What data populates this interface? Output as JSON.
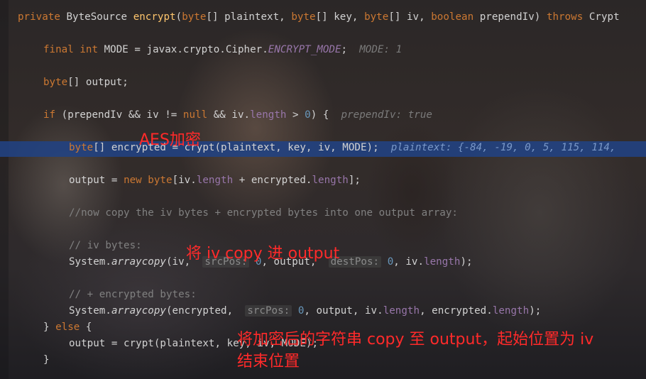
{
  "code_lines": [
    "private ByteSource encrypt(byte[] plaintext, byte[] key, byte[] iv, boolean prependIv) throws Crypt",
    "final int MODE = javax.crypto.Cipher.ENCRYPT_MODE;",
    "byte[] output;",
    "if (prependIv && iv != null && iv.length > 0) {",
    "byte[] encrypted = crypt(plaintext, key, iv, MODE);",
    "output = new byte[iv.length + encrypted.length];",
    "//now copy the iv bytes + encrypted bytes into one output array:",
    "// iv bytes:",
    "System.arraycopy(iv, srcPos: 0, output, destPos: 0, iv.length);",
    "// + encrypted bytes:",
    "System.arraycopy(encrypted, srcPos: 0, output, iv.length, encrypted.length);",
    "} else {",
    "output = crypt(plaintext, key, iv, MODE);",
    "}"
  ],
  "debug_hints": {
    "mode": "MODE: 1",
    "prepend_iv": "prependIv: true",
    "plaintext": "plaintext: {-84, -19, 0, 5, 115, 114,"
  },
  "param_hints": {
    "src_pos_1": "srcPos:",
    "dest_pos": "destPos:",
    "src_pos_2": "srcPos:"
  },
  "annotations": {
    "aes": "AES加密",
    "iv_copy": "将 iv copy 进 output",
    "encrypted_copy_line1": "将加密后的字符串 copy 至 output，起始位置为 iv",
    "encrypted_copy_line2": "结束位置"
  },
  "colors": {
    "keyword": "#cc7832",
    "method": "#ffc66d",
    "field": "#9876aa",
    "number": "#6897bb",
    "comment": "#808080",
    "highlight_line": "#214283",
    "annotation": "#ff2a2a"
  }
}
